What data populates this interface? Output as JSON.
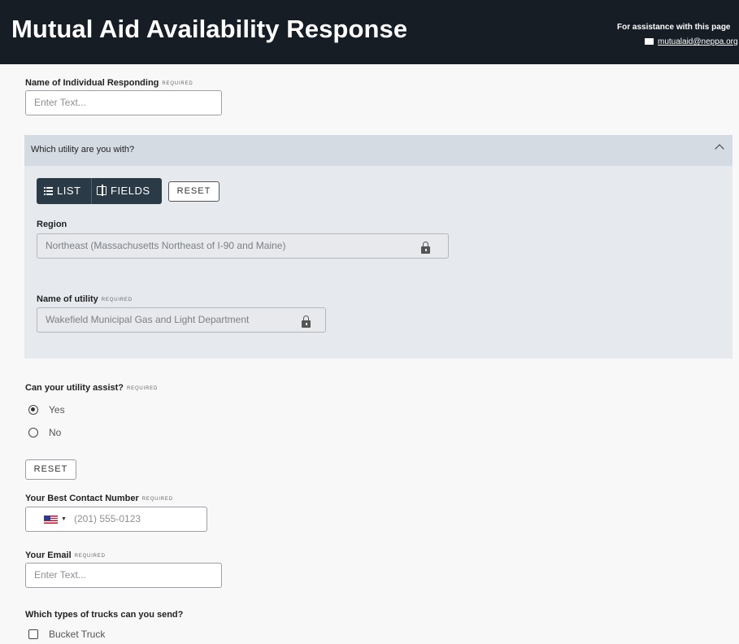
{
  "header": {
    "title": "Mutual Aid Availability Response",
    "assist_text": "For assistance with this page",
    "email": "mutualaid@neppa.org"
  },
  "individual": {
    "label": "Name of Individual Responding",
    "required": "REQUIRED",
    "placeholder": "Enter Text..."
  },
  "utility_section": {
    "title": "Which utility are you with?",
    "toggle": {
      "list_label": "LIST",
      "fields_label": "FIELDS",
      "active": "LIST"
    },
    "reset_label": "RESET",
    "region": {
      "label": "Region",
      "value": "Northeast (Massachusetts Northeast of I-90 and Maine)"
    },
    "utility_name": {
      "label": "Name of utility",
      "required": "REQUIRED",
      "value": "Wakefield Municipal Gas and Light Department"
    }
  },
  "assist": {
    "label": "Can your utility assist?",
    "required": "REQUIRED",
    "options": [
      {
        "label": "Yes",
        "checked": true
      },
      {
        "label": "No",
        "checked": false
      }
    ],
    "reset_label": "RESET"
  },
  "contact": {
    "label": "Your Best Contact Number",
    "required": "REQUIRED",
    "placeholder": "(201) 555-0123",
    "country": "US"
  },
  "email": {
    "label": "Your Email",
    "required": "REQUIRED",
    "placeholder": "Enter Text..."
  },
  "trucks": {
    "label": "Which types of trucks can you send?",
    "options": [
      {
        "label": "Bucket Truck",
        "checked": false
      }
    ]
  },
  "colors": {
    "header_bg": "#161d25",
    "section_bg": "#e6eaef",
    "section_head_bg": "#d5dbe3",
    "toggle_bg": "#2b3a47"
  }
}
